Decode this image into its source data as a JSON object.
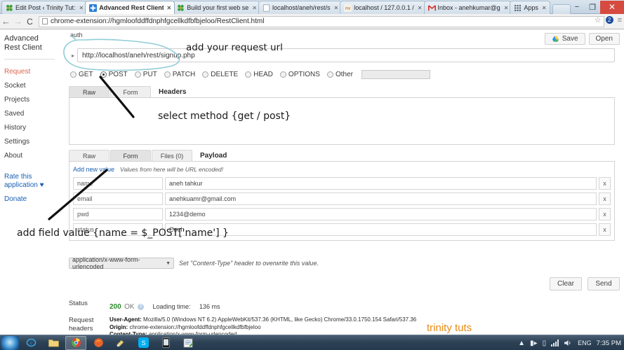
{
  "browser": {
    "tabs": [
      {
        "title": "Edit Post ‹ Trinity Tut:",
        "favicon": "wordpress-icon",
        "active": false
      },
      {
        "title": "Advanced Rest Client",
        "favicon": "arc-icon",
        "active": true
      },
      {
        "title": "Build your first web se",
        "favicon": "wordpress-icon",
        "active": false
      },
      {
        "title": "localhost/aneh/rest/s",
        "favicon": "page-icon",
        "active": false
      },
      {
        "title": "localhost / 127.0.0.1 /",
        "favicon": "phpmyadmin-icon",
        "active": false
      },
      {
        "title": "Inbox - anehkumar@g",
        "favicon": "gmail-icon",
        "active": false
      },
      {
        "title": "Apps",
        "favicon": "apps-icon",
        "active": false
      }
    ],
    "tab_close_glyph": "✕",
    "window": {
      "minimize": "−",
      "maximize": "❐",
      "close": "✕"
    },
    "nav": {
      "back": "←",
      "forward": "→",
      "reload": "C"
    },
    "url": "chrome-extension://hgmloofddffdnphfgcellkdfbfbjeloo/RestClient.html",
    "omnibox_icons": {
      "star": "☆",
      "profile": "2",
      "menu": "≡"
    }
  },
  "sidebar": {
    "brand": "Advanced Rest Client",
    "items": [
      {
        "label": "Request",
        "active": true
      },
      {
        "label": "Socket",
        "active": false
      },
      {
        "label": "Projects",
        "active": false
      },
      {
        "label": "Saved",
        "active": false
      },
      {
        "label": "History",
        "active": false
      },
      {
        "label": "Settings",
        "active": false
      },
      {
        "label": "About",
        "active": false
      }
    ],
    "links": [
      {
        "label": "Rate this application ♥"
      },
      {
        "label": "Donate"
      }
    ]
  },
  "request": {
    "auth_label": "auth",
    "save_label": "Save",
    "open_label": "Open",
    "drive_icon": "google-drive-icon",
    "url_value": "http://localhost/aneh/rest/signup.php",
    "url_caret": "▸",
    "methods": [
      {
        "label": "GET",
        "selected": false
      },
      {
        "label": "POST",
        "selected": true
      },
      {
        "label": "PUT",
        "selected": false
      },
      {
        "label": "PATCH",
        "selected": false
      },
      {
        "label": "DELETE",
        "selected": false
      },
      {
        "label": "HEAD",
        "selected": false
      },
      {
        "label": "OPTIONS",
        "selected": false
      },
      {
        "label": "Other",
        "selected": false
      }
    ],
    "other_value": ""
  },
  "headers_section": {
    "tabs": [
      {
        "label": "Raw",
        "selected": true
      },
      {
        "label": "Form",
        "selected": false
      }
    ],
    "title": "Headers",
    "textarea_value": ""
  },
  "payload_section": {
    "tabs": [
      {
        "label": "Raw",
        "selected": false
      },
      {
        "label": "Form",
        "selected": true
      },
      {
        "label": "Files (0)",
        "selected": false
      }
    ],
    "title": "Payload",
    "add_new_value": "Add new value",
    "encoded_note": "Values from here will be URL encoded!",
    "remove_glyph": "x",
    "fields": [
      {
        "key": "name",
        "value": "aneh tahkur"
      },
      {
        "key": "email",
        "value": "anehkuamr@gmail.com"
      },
      {
        "key": "pwd",
        "value": "1234@demo"
      },
      {
        "key": "status",
        "value": "Coeh"
      }
    ]
  },
  "content_type": {
    "selected": "application/x-www-form-urlencoded",
    "arrow": "▼",
    "note": "Set \"Content-Type\" header to overwrite this value."
  },
  "actions": {
    "clear": "Clear",
    "send": "Send"
  },
  "result": {
    "status_label": "Status",
    "status_code": "200",
    "status_text": "OK",
    "help_glyph": "?",
    "loading_label": "Loading time:",
    "loading_value": "136 ms",
    "request_headers_label": "Request headers",
    "headers": [
      {
        "name": "User-Agent:",
        "value": "Mozilla/5.0 (Windows NT 6.2) AppleWebKit/537.36 (KHTML, like Gecko) Chrome/33.0.1750.154 Safari/537.36"
      },
      {
        "name": "Origin:",
        "value": "chrome-extension://hgmloofddffdnphfgcellkdfbfbjeloo"
      },
      {
        "name": "Content-Type:",
        "value": "application/x-www-form-urlencoded"
      }
    ]
  },
  "annotations": {
    "note_url": "add your request url",
    "note_method": "select method {get / post}",
    "note_field": "add field value {name = $_POST['name'] }",
    "watermark": "trinity tuts",
    "ink_color": "#8fcdd6",
    "arrow_color": "#111111",
    "watermark_color": "#e98b16"
  },
  "taskbar": {
    "start": "start-orb",
    "items": [
      {
        "icon": "internet-explorer-icon",
        "active": false
      },
      {
        "icon": "explorer-folder-icon",
        "active": false
      },
      {
        "icon": "chrome-icon",
        "active": true
      },
      {
        "icon": "firefox-icon",
        "active": false
      },
      {
        "icon": "paint-icon",
        "active": false
      },
      {
        "icon": "skype-icon",
        "active": false
      },
      {
        "icon": "phone-icon",
        "active": false
      },
      {
        "icon": "notepad-icon",
        "active": false
      }
    ],
    "tray": {
      "expand": "▲",
      "network": "▮▸",
      "device": "▯",
      "signal": "signal-icon",
      "volume": "volume-icon",
      "language": "ENG",
      "clock": "7:35 PM"
    }
  }
}
